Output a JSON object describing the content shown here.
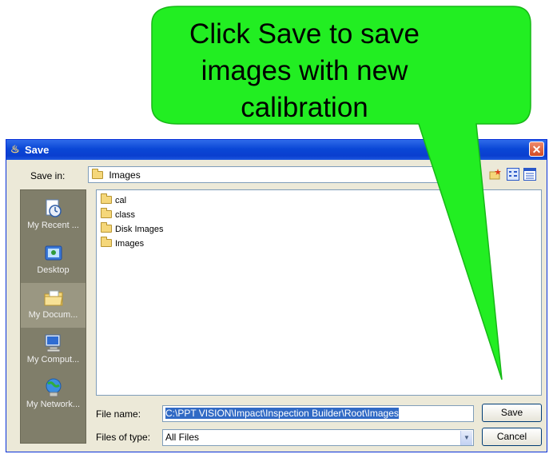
{
  "callout": {
    "line1": "Click Save to save",
    "line2": "images with new",
    "line3": "calibration",
    "fill": "#22ee22"
  },
  "window": {
    "title": "Save",
    "title_icon": "java-cup-icon",
    "close_glyph": "✕"
  },
  "save_in": {
    "label": "Save in:",
    "value": "Images"
  },
  "places": [
    {
      "label": "My Recent ...",
      "icon": "recent-docs-icon"
    },
    {
      "label": "Desktop",
      "icon": "desktop-icon"
    },
    {
      "label": "My Docum...",
      "icon": "my-documents-icon"
    },
    {
      "label": "My Comput...",
      "icon": "my-computer-icon"
    },
    {
      "label": "My Network...",
      "icon": "network-icon"
    }
  ],
  "files": [
    {
      "name": "cal"
    },
    {
      "name": "class"
    },
    {
      "name": "Disk Images"
    },
    {
      "name": "Images"
    }
  ],
  "filename": {
    "label": "File name:",
    "value": "C:\\PPT VISION\\Impact\\Inspection Builder\\Root\\Images"
  },
  "filetype": {
    "label": "Files of type:",
    "value": "All Files"
  },
  "buttons": {
    "save": "Save",
    "cancel": "Cancel"
  }
}
